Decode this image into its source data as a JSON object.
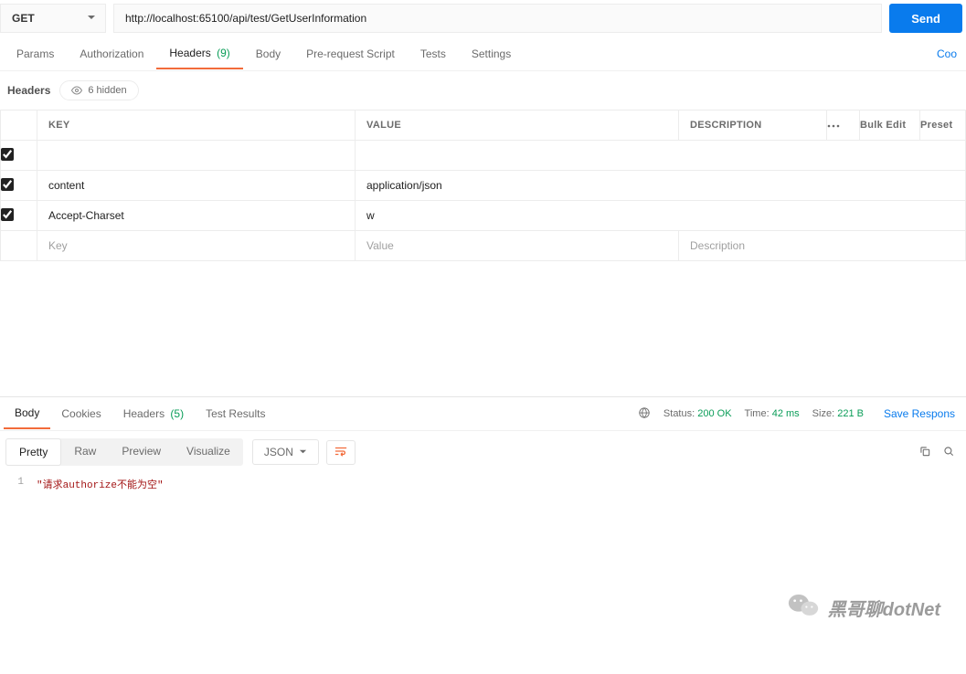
{
  "request": {
    "method": "GET",
    "url": "http://localhost:65100/api/test/GetUserInformation",
    "send_label": "Send"
  },
  "request_tabs": {
    "params": "Params",
    "auth": "Authorization",
    "headers": "Headers",
    "headers_count": "(9)",
    "body": "Body",
    "prerequest": "Pre-request Script",
    "tests": "Tests",
    "settings": "Settings",
    "right_link": "Coo"
  },
  "headers_section": {
    "title": "Headers",
    "hidden_label": "6 hidden",
    "col_key": "KEY",
    "col_value": "VALUE",
    "col_desc": "DESCRIPTION",
    "bulk_edit": "Bulk Edit",
    "presets": "Preset",
    "rows": [
      {
        "checked": true,
        "key": "",
        "value": "",
        "desc": ""
      },
      {
        "checked": true,
        "key": "content",
        "value": "application/json",
        "desc": ""
      },
      {
        "checked": true,
        "key": "Accept-Charset",
        "value": "w",
        "desc": ""
      }
    ],
    "placeholder_key": "Key",
    "placeholder_value": "Value",
    "placeholder_desc": "Description"
  },
  "response_tabs": {
    "body": "Body",
    "cookies": "Cookies",
    "headers": "Headers",
    "headers_count": "(5)",
    "tests": "Test Results"
  },
  "response_meta": {
    "status_label": "Status:",
    "status_value": "200 OK",
    "time_label": "Time:",
    "time_value": "42 ms",
    "size_label": "Size:",
    "size_value": "221 B",
    "save_label": "Save Respons"
  },
  "response_views": {
    "pretty": "Pretty",
    "raw": "Raw",
    "preview": "Preview",
    "visualize": "Visualize",
    "format": "JSON"
  },
  "response_body": {
    "line1_no": "1",
    "line1_text": "\"请求authorize不能为空\""
  },
  "watermark": "黑哥聊dotNet"
}
